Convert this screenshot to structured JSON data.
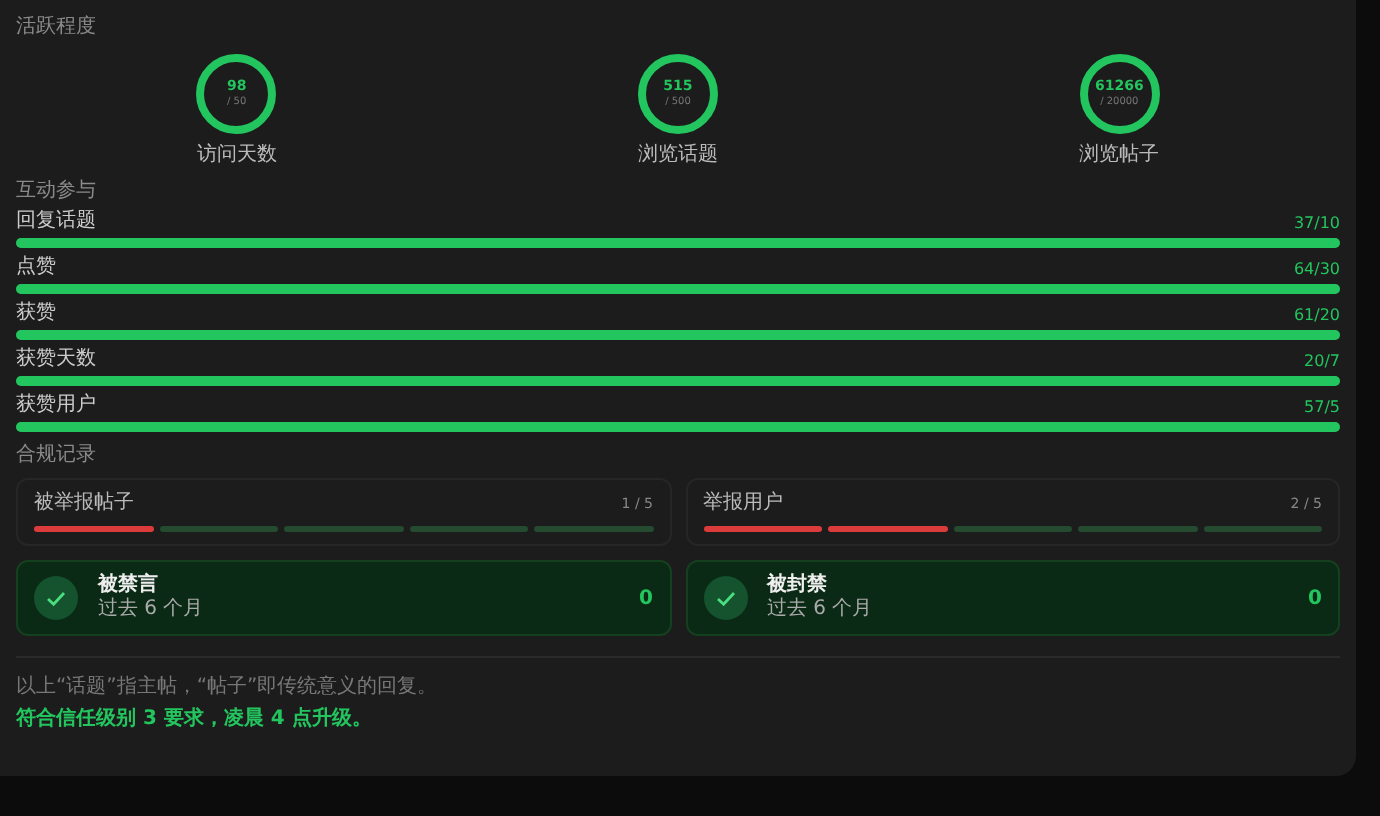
{
  "activity": {
    "title": "活跃程度",
    "rings": [
      {
        "value": "98",
        "target": "/ 50",
        "label": "访问天数"
      },
      {
        "value": "515",
        "target": "/ 500",
        "label": "浏览话题"
      },
      {
        "value": "61266",
        "target": "/ 20000",
        "label": "浏览帖子"
      }
    ]
  },
  "participation": {
    "title": "互动参与",
    "bars": [
      {
        "label": "回复话题",
        "reading": "37/10",
        "level": 1
      },
      {
        "label": "点赞",
        "reading": "64/30",
        "level": 1
      },
      {
        "label": "获赞",
        "reading": "61/20",
        "level": 1
      },
      {
        "label": "获赞天数",
        "reading": "20/7",
        "level": 1
      },
      {
        "label": "获赞用户",
        "reading": "57/5",
        "level": 1
      }
    ]
  },
  "compliance": {
    "title": "合规记录",
    "reports": [
      {
        "label": "被举报帖子",
        "reading": "1 / 5",
        "segments": [
          {
            "filled": true
          },
          {
            "filled": false
          },
          {
            "filled": false
          },
          {
            "filled": false
          },
          {
            "filled": false
          }
        ]
      },
      {
        "label": "举报用户",
        "reading": "2 / 5",
        "segments": [
          {
            "filled": true
          },
          {
            "filled": true
          },
          {
            "filled": false
          },
          {
            "filled": false
          },
          {
            "filled": false
          }
        ]
      }
    ],
    "penalties": [
      {
        "title": "被禁言",
        "period": "过去 6 个月",
        "count": "0",
        "ok": true
      },
      {
        "title": "被封禁",
        "period": "过去 6 个月",
        "count": "0",
        "ok": true
      }
    ]
  },
  "notes": {
    "text": "以上“话题”指主帖，“帖子”即传统意义的回复。",
    "status": "符合信任级别 3 要求，凌晨 4 点升级。"
  }
}
